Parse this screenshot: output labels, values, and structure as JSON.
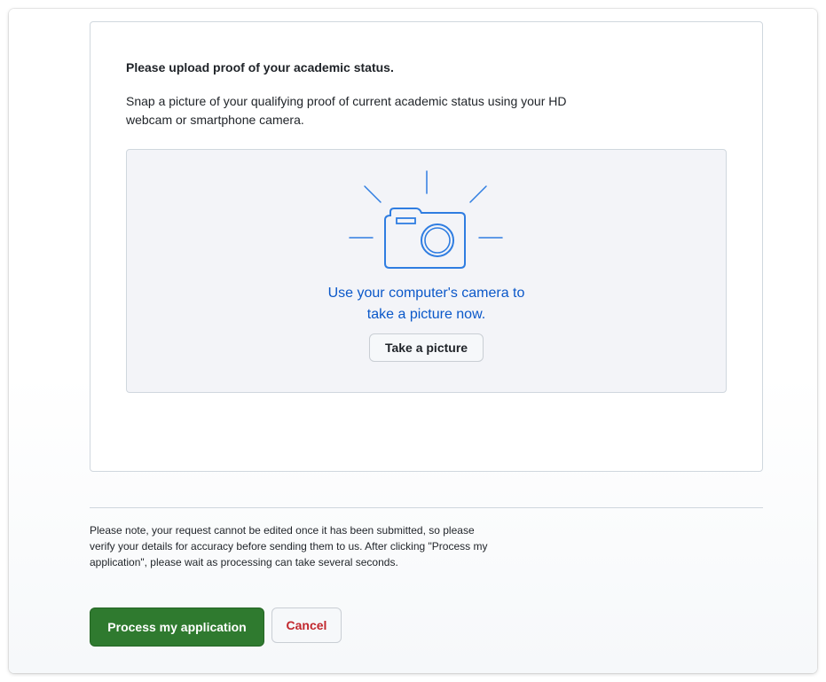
{
  "upload": {
    "heading": "Please upload proof of your academic status.",
    "description": "Snap a picture of your qualifying proof of current academic status using your HD webcam or smartphone camera.",
    "camera_icon": "camera-icon",
    "prompt_line1": "Use your computer's camera to",
    "prompt_line2": "take a picture now.",
    "take_picture_label": "Take a picture"
  },
  "footer": {
    "note": "Please note, your request cannot be edited once it has been submitted, so please verify your details for accuracy before sending them to us. After clicking \"Process my application\", please wait as processing can take several seconds.",
    "process_label": "Process my application",
    "cancel_label": "Cancel"
  },
  "colors": {
    "accent_blue": "#0b58c9",
    "camera_icon": "#2f7de1",
    "primary_green": "#2f7a2f",
    "cancel_red": "#c1272d"
  }
}
